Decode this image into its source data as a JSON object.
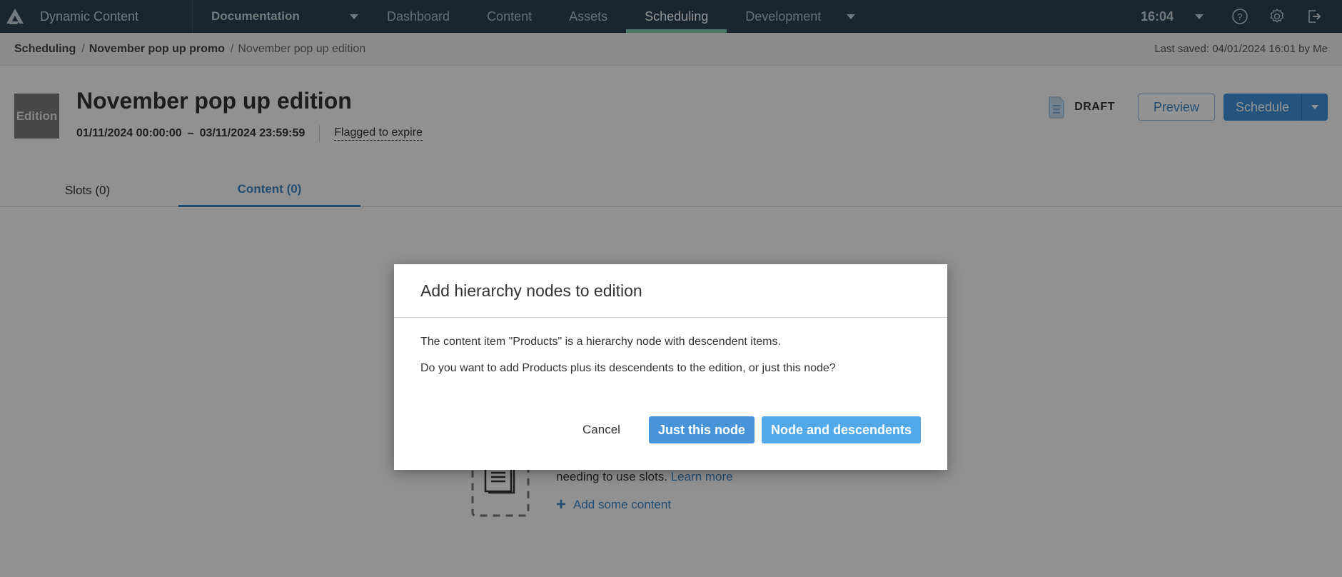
{
  "topbar": {
    "app_name": "Dynamic Content",
    "hub_name": "Documentation",
    "nav": [
      {
        "label": "Dashboard",
        "active": false
      },
      {
        "label": "Content",
        "active": false
      },
      {
        "label": "Assets",
        "active": false
      },
      {
        "label": "Scheduling",
        "active": true
      },
      {
        "label": "Development",
        "active": false
      }
    ],
    "clock": "16:04",
    "icons": [
      "help-icon",
      "settings-icon",
      "logout-icon"
    ]
  },
  "breadcrumb": {
    "items": [
      "Scheduling",
      "November pop up promo",
      "November pop up edition"
    ],
    "separator": "/",
    "last_saved": "Last saved: 04/01/2024 16:01 by Me"
  },
  "edition": {
    "badge": "Edition",
    "title": "November pop up edition",
    "start": "01/11/2024 00:00:00",
    "dash": "–",
    "end": "03/11/2024 23:59:59",
    "flag": "Flagged to expire",
    "status": "DRAFT",
    "preview_label": "Preview",
    "schedule_label": "Schedule"
  },
  "tabs": [
    {
      "label": "Slots (0)",
      "active": false
    },
    {
      "label": "Content (0)",
      "active": true
    }
  ],
  "empty_state": {
    "text": "needing to use slots.",
    "learn_more": "Learn more",
    "add_content": "Add some content"
  },
  "modal": {
    "title": "Add hierarchy nodes to edition",
    "paragraph1": "The content item \"Products\" is a hierarchy node with descendent items.",
    "paragraph2": "Do you want to add Products plus its descendents to the edition, or just this node?",
    "cancel_label": "Cancel",
    "just_node_label": "Just this node",
    "node_desc_label": "Node and descendents"
  },
  "colors": {
    "topbar_bg": "#2e4053",
    "active_tab_indicator": "#7fd3b4",
    "accent_blue": "#3c85c6",
    "primary_button": "#4894d9",
    "secondary_button": "#52a9ea"
  }
}
